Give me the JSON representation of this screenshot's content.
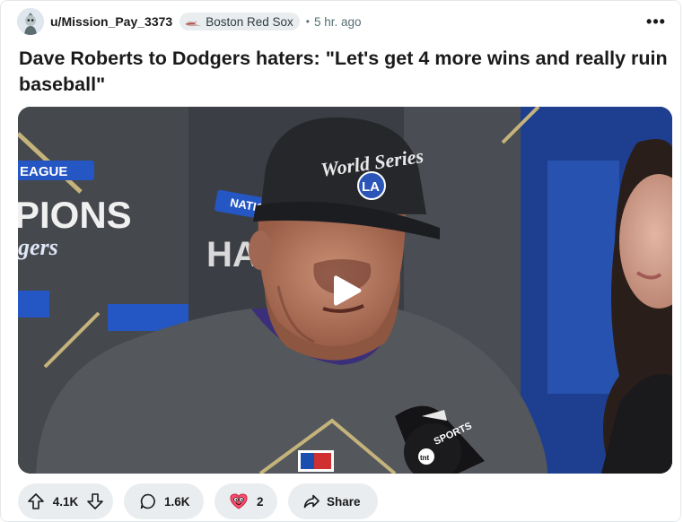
{
  "post": {
    "username": "u/Mission_Pay_3373",
    "flair": "Boston Red Sox",
    "separator": "•",
    "time": "5 hr. ago",
    "more_label": "•••",
    "title": "Dave Roberts to Dodgers haters: \"Let's get 4 more wins and really ruin baseball\""
  },
  "video": {
    "cap_text": "World Series",
    "cap_logo": "LA",
    "shirt_text_left_1": "EAGUE",
    "shirt_text_left_2": "PIONS",
    "shirt_text_left_3": "gers",
    "shirt_text_mid_1": "NATIO",
    "shirt_text_mid_2": "HAM",
    "mic_text": "SPORTS",
    "mic_logo": "tnt"
  },
  "actions": {
    "upvotes": "4.1K",
    "comments": "1.6K",
    "awards": "2",
    "share_label": "Share"
  },
  "colors": {
    "pill_bg": "#eaedef",
    "muted": "#576f76",
    "text": "#1a1a1b"
  },
  "icons": [
    "snoo-avatar-icon",
    "red-sox-flair-icon",
    "more-options-icon",
    "play-icon",
    "upvote-icon",
    "downvote-icon",
    "comment-icon",
    "award-icon",
    "share-icon"
  ]
}
